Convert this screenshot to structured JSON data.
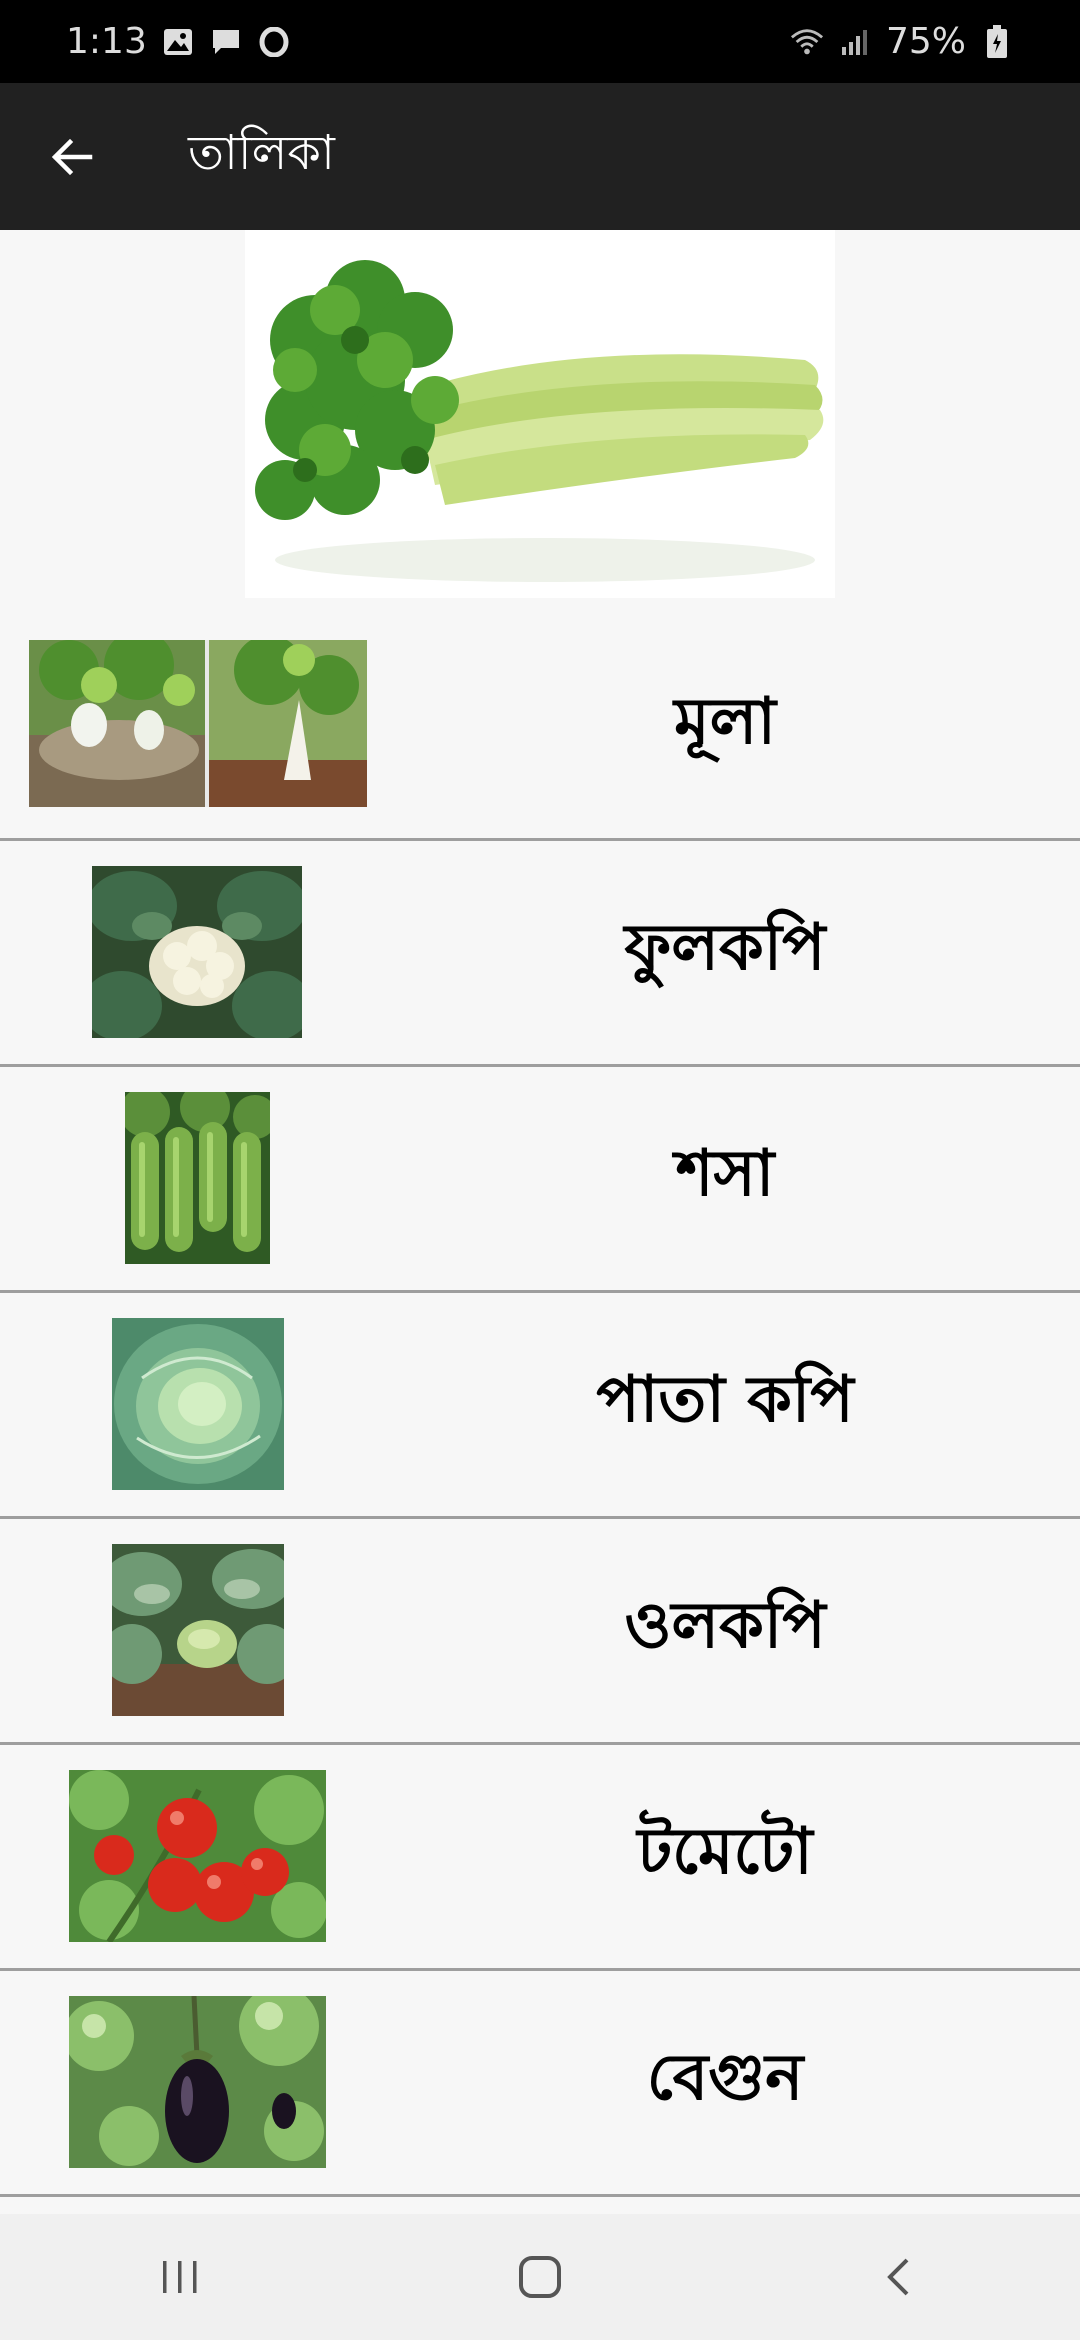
{
  "status_bar": {
    "time": "1:13",
    "battery": "75%",
    "left_icons": [
      "image-icon",
      "message-icon",
      "opera-icon"
    ],
    "right_icons": [
      "wifi-icon",
      "signal-icon",
      "battery-icon"
    ]
  },
  "app_bar": {
    "title": "তালিকা",
    "back_icon": "arrow-left-icon"
  },
  "hero": {
    "image": "celery-image"
  },
  "list": {
    "items": [
      {
        "label": "মূলা",
        "image": "radish-image"
      },
      {
        "label": "ফুলকপি",
        "image": "cauliflower-image"
      },
      {
        "label": "শসা",
        "image": "cucumber-image"
      },
      {
        "label": "পাতা কপি",
        "image": "cabbage-image"
      },
      {
        "label": "ওলকপি",
        "image": "kohlrabi-image"
      },
      {
        "label": "টমেটো",
        "image": "tomato-image"
      },
      {
        "label": "বেগুন",
        "image": "eggplant-image"
      }
    ]
  },
  "nav_bar": {
    "buttons": [
      "recent-apps-icon",
      "home-icon",
      "back-icon"
    ]
  },
  "colors": {
    "status_bar": "#000000",
    "app_bar": "#212121",
    "background": "#f7f7f7",
    "divider": "#9e9e9e",
    "nav_bar": "#f0f0f0"
  }
}
